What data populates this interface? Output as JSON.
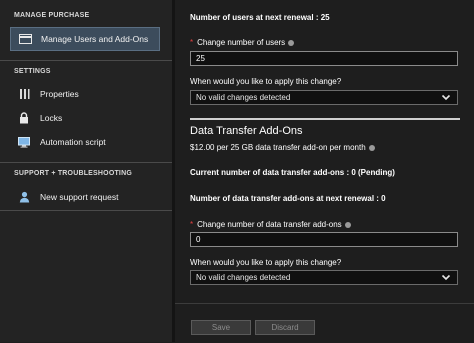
{
  "sidebar": {
    "manage_purchase_header": "MANAGE PURCHASE",
    "settings_header": "SETTINGS",
    "support_header": "SUPPORT + TROUBLESHOOTING",
    "items": {
      "manage_users": {
        "label": "Manage Users and Add-Ons",
        "icon": "card-icon"
      },
      "properties": {
        "label": "Properties",
        "icon": "properties-icon"
      },
      "locks": {
        "label": "Locks",
        "icon": "lock-icon"
      },
      "automation": {
        "label": "Automation script",
        "icon": "monitor-icon"
      },
      "support": {
        "label": "New support request",
        "icon": "support-person-icon"
      }
    }
  },
  "main": {
    "users_at_renewal": "Number of users at next renewal : 25",
    "change_users_label": "Change number of users",
    "change_users_value": "25",
    "apply_change_label_1": "When would you like to apply this change?",
    "apply_change_value_1": "No valid changes detected",
    "data_transfer_title": "Data Transfer Add-Ons",
    "data_transfer_price": "$12.00 per 25 GB data transfer add-on per month",
    "current_addons": "Current number of data transfer add-ons : 0 (Pending)",
    "addons_at_renewal": "Number of data transfer add-ons at next renewal : 0",
    "change_addons_label": "Change number of data transfer add-ons",
    "change_addons_value": "0",
    "apply_change_label_2": "When would you like to apply this change?",
    "apply_change_value_2": "No valid changes detected",
    "required_mark": "*"
  },
  "footer": {
    "save_label": "Save",
    "discard_label": "Discard"
  },
  "colors": {
    "background": "#1e1e1e",
    "sidebar": "#232323",
    "active_item": "#3c4c5c",
    "required": "#e04040"
  }
}
